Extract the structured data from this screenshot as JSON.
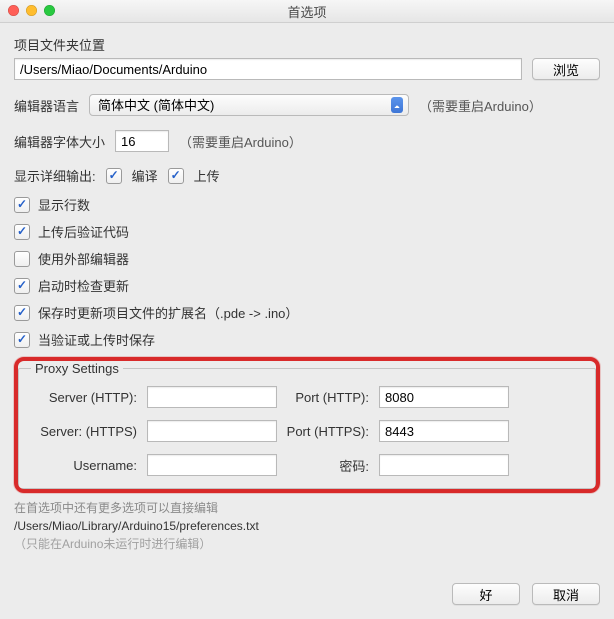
{
  "window": {
    "title": "首选项"
  },
  "sketchbook": {
    "label": "项目文件夹位置",
    "value": "/Users/Miao/Documents/Arduino",
    "browse": "浏览"
  },
  "language": {
    "label": "编辑器语言",
    "value": "简体中文 (简体中文)",
    "note": "（需要重启Arduino）"
  },
  "fontsize": {
    "label": "编辑器字体大小",
    "value": "16",
    "note": "（需要重启Arduino）"
  },
  "verbose": {
    "label": "显示详细输出:",
    "compile_label": "编译",
    "compile_checked": true,
    "upload_label": "上传",
    "upload_checked": true
  },
  "options": [
    {
      "label": "显示行数",
      "checked": true
    },
    {
      "label": "上传后验证代码",
      "checked": true
    },
    {
      "label": "使用外部编辑器",
      "checked": false
    },
    {
      "label": "启动时检查更新",
      "checked": true
    },
    {
      "label": "保存时更新项目文件的扩展名（.pde -> .ino）",
      "checked": true
    },
    {
      "label": "当验证或上传时保存",
      "checked": true
    }
  ],
  "proxy": {
    "legend": "Proxy Settings",
    "server_http_label": "Server (HTTP):",
    "server_http_value": "",
    "port_http_label": "Port (HTTP):",
    "port_http_value": "8080",
    "server_https_label": "Server: (HTTPS)",
    "server_https_value": "",
    "port_https_label": "Port (HTTPS):",
    "port_https_value": "8443",
    "username_label": "Username:",
    "username_value": "",
    "password_label": "密码:",
    "password_value": ""
  },
  "footer": {
    "more": "在首选项中还有更多选项可以直接编辑",
    "path": "/Users/Miao/Library/Arduino15/preferences.txt",
    "only": "（只能在Arduino未运行时进行编辑）"
  },
  "buttons": {
    "ok": "好",
    "cancel": "取消"
  }
}
